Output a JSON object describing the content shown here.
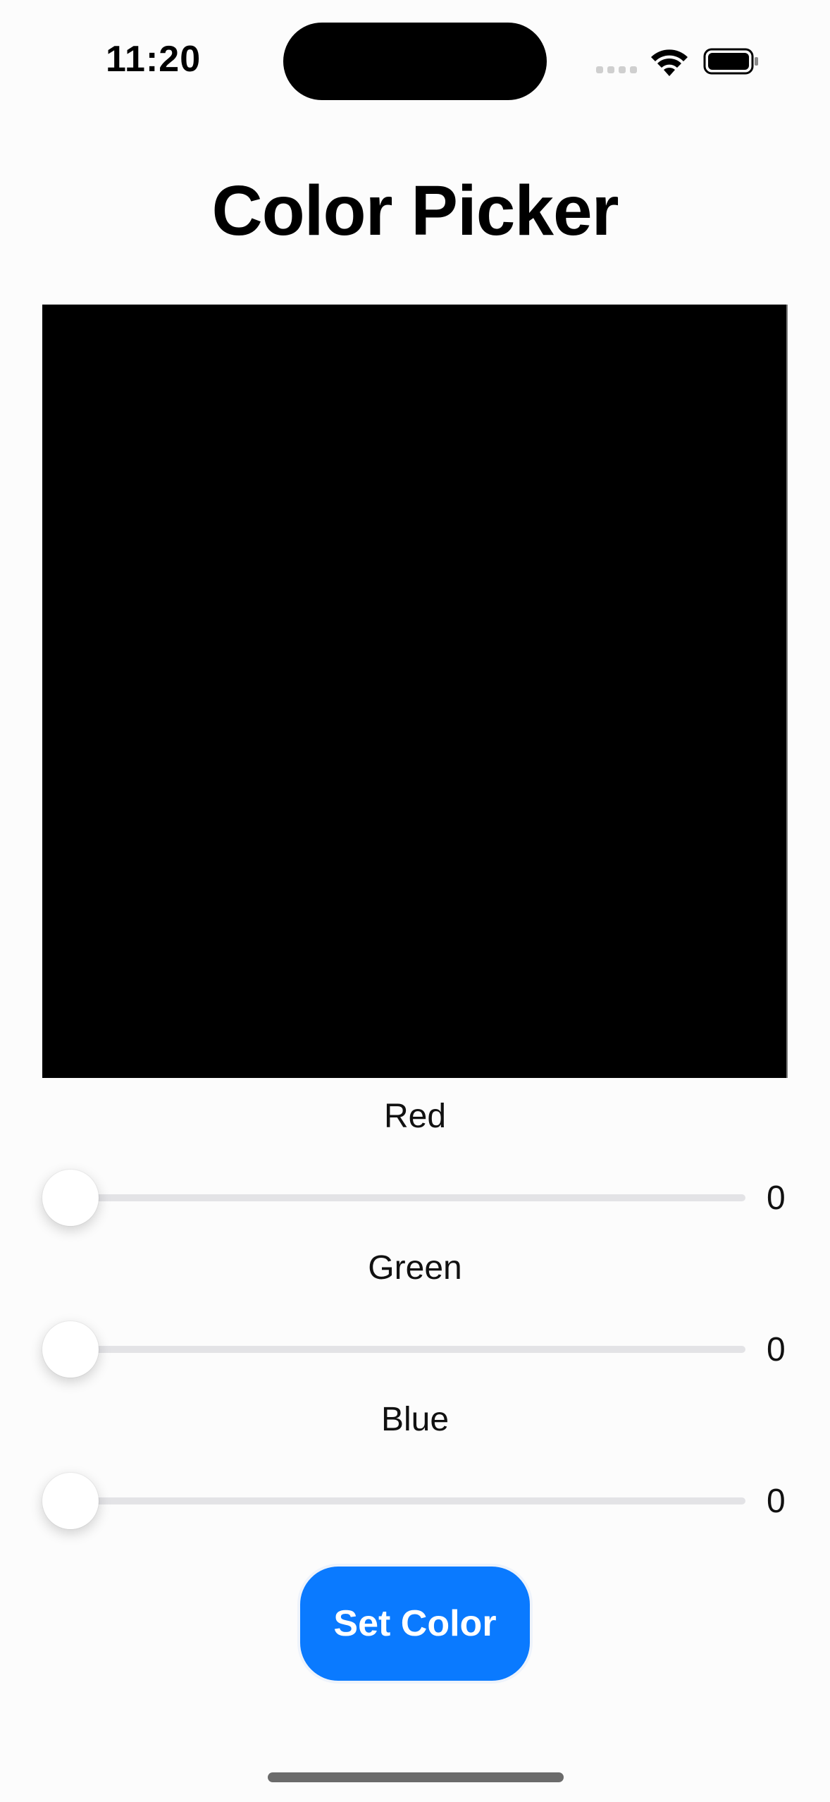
{
  "status_bar": {
    "time": "11:20"
  },
  "page": {
    "title": "Color Picker",
    "preview_color": "#000000"
  },
  "sliders": [
    {
      "label": "Red",
      "value": "0",
      "fraction": 0
    },
    {
      "label": "Green",
      "value": "0",
      "fraction": 0
    },
    {
      "label": "Blue",
      "value": "0",
      "fraction": 0
    }
  ],
  "button": {
    "label": "Set Color",
    "color": "#0a7aff"
  },
  "icons": {
    "wifi": "wifi-icon",
    "battery": "battery-icon",
    "signal": "cellular-signal-icon"
  }
}
